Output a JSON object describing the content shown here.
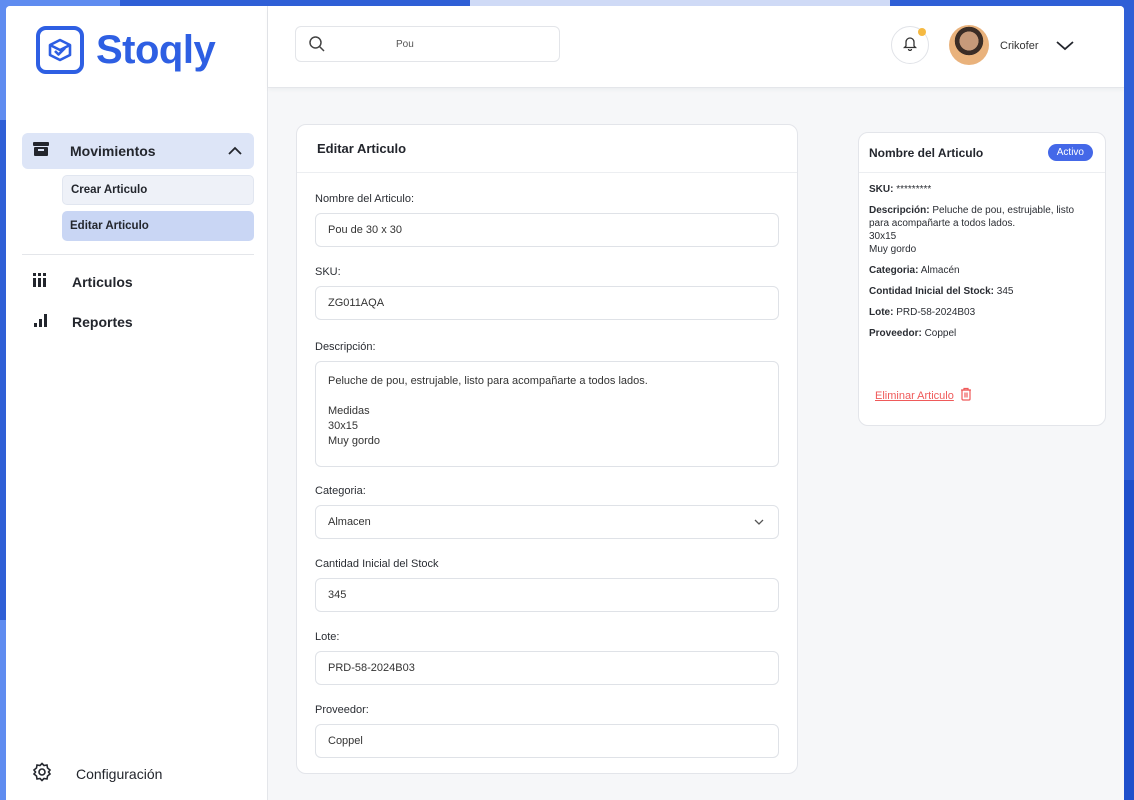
{
  "brand": {
    "name": "Stoqly",
    "accent": "#2e5fe3"
  },
  "sidebar": {
    "group": {
      "label": "Movimientos",
      "icon": "archive-icon",
      "items": [
        {
          "label": "Crear Articulo"
        },
        {
          "label": "Editar Articulo"
        }
      ]
    },
    "items": [
      {
        "label": "Articulos",
        "icon": "barcode-icon"
      },
      {
        "label": "Reportes",
        "icon": "bar-chart-icon"
      }
    ],
    "settings": {
      "label": "Configuración",
      "icon": "gear-icon"
    }
  },
  "header": {
    "search": {
      "value": "Pou"
    },
    "user": {
      "name": "Crikofer"
    }
  },
  "form": {
    "title": "Editar Articulo",
    "fields": {
      "name": {
        "label": "Nombre del Articulo:",
        "value": "Pou de 30 x 30"
      },
      "sku": {
        "label": "SKU:",
        "value": "ZG011AQA"
      },
      "description": {
        "label": "Descripción:",
        "lines": [
          "Peluche de pou, estrujable, listo para acompañarte a todos lados.",
          "",
          "Medidas",
          "30x15",
          "Muy gordo"
        ]
      },
      "category": {
        "label": "Categoria:",
        "value": "Almacen"
      },
      "stock": {
        "label": "Cantidad Inicial del Stock",
        "value": "345"
      },
      "lot": {
        "label": "Lote:",
        "value": "PRD-58-2024B03"
      },
      "supplier": {
        "label": "Proveedor:",
        "value": "Coppel"
      }
    }
  },
  "summary": {
    "title": "Nombre del Articulo",
    "status": "Activo",
    "sku": {
      "label": "SKU:",
      "value": "*********"
    },
    "description": {
      "label": "Descripción:",
      "value": "Peluche de pou, estrujable, listo para acompañarte a todos lados.",
      "extra": [
        "30x15",
        "Muy gordo"
      ]
    },
    "category": {
      "label": "Categoria:",
      "value": "Almacén"
    },
    "stock": {
      "label": "Contidad Inicial del Stock:",
      "value": "345"
    },
    "lot": {
      "label": "Lote:",
      "value": "PRD-58-2024B03"
    },
    "supplier": {
      "label": "Proveedor:",
      "value": "Coppel"
    },
    "delete_label": "Eliminar Articulo",
    "delete_color": "#ef5a5a"
  }
}
